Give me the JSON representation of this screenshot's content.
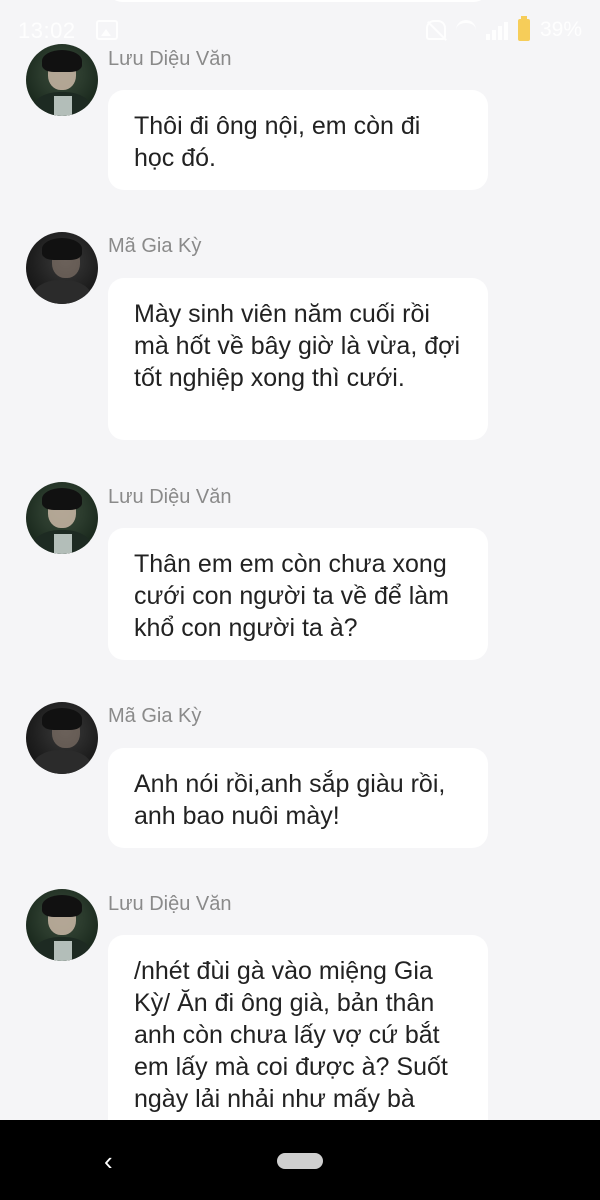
{
  "status_bar": {
    "time": "13:02",
    "battery": "39%",
    "icons": [
      "image-icon",
      "bell-off-icon",
      "wifi-icon",
      "signal-icon",
      "battery-icon"
    ]
  },
  "messages": [
    {
      "sender": "Lưu Diệu Văn",
      "avatar": "avatar-luu",
      "text": "Thôi đi ông nội, em còn đi học đó."
    },
    {
      "sender": "Mã Gia Kỳ",
      "avatar": "avatar-ma",
      "text": "Mày sinh viên năm cuối rồi mà hốt về bây giờ là vừa, đợi tốt nghiệp xong thì cưới."
    },
    {
      "sender": "Lưu Diệu Văn",
      "avatar": "avatar-luu",
      "text": "Thân em em còn chưa xong cưới con người ta về để làm khổ con người ta à?"
    },
    {
      "sender": "Mã Gia Kỳ",
      "avatar": "avatar-ma",
      "text": "Anh nói rồi,anh sắp giàu rồi, anh bao nuôi mày!"
    },
    {
      "sender": "Lưu Diệu Văn",
      "avatar": "avatar-luu",
      "text": "/nhét đùi gà vào miệng Gia Kỳ/ Ăn đi ông già, bản thân anh còn chưa lấy vợ cứ bắt em lấy mà coi được à? Suốt ngày lải nhải như mấy bà"
    }
  ],
  "nav_bar": {
    "back_icon": "‹"
  },
  "colors": {
    "background": "#f5f5f7",
    "bubble": "#ffffff",
    "name_text": "#8a8a8a",
    "message_text": "#222222",
    "nav_bar": "#000000"
  }
}
